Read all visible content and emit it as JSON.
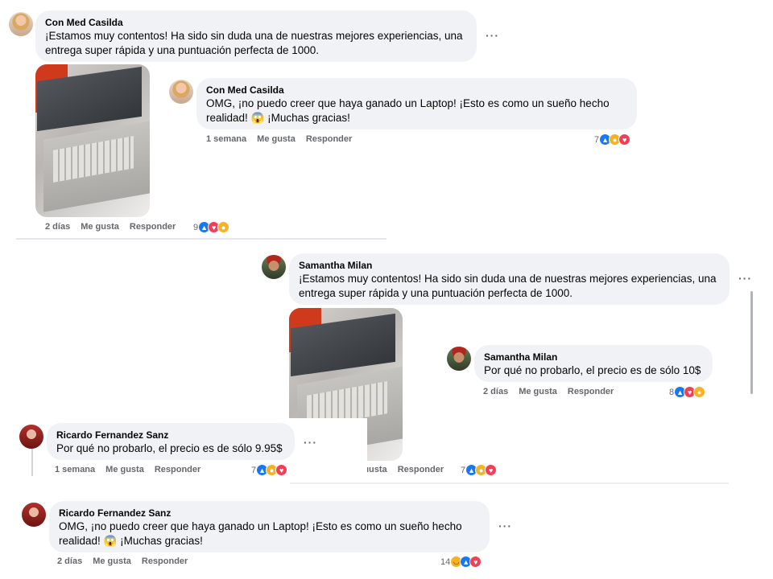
{
  "comment1": {
    "author": "Con Med Casilda",
    "text": "¡Estamos muy contentos! Ha sido sin duda una de nuestras mejores experiencias, una entrega super rápida y una puntuación perfecta de 1000.",
    "time": "2 días",
    "like_label": "Me gusta",
    "reply_label": "Responder",
    "reaction_count": "9",
    "reactions": [
      "like-icon",
      "love-icon",
      "care-icon"
    ]
  },
  "reply1": {
    "author": "Con Med Casilda",
    "text_a": "OMG, ¡no puedo creer que haya ganado un Laptop! ¡Esto es como un sueño hecho realidad!",
    "emoji": "😱",
    "text_b": "¡Muchas gracias!",
    "time": "1 semana",
    "like_label": "Me gusta",
    "reply_label": "Responder",
    "reaction_count": "7",
    "reactions": [
      "like-icon",
      "care-icon",
      "love-icon"
    ]
  },
  "comment2": {
    "author": "Samantha Milan",
    "text": "¡Estamos muy contentos! Ha sido sin duda una de nuestras mejores experiencias, una entrega super rápida y una puntuación perfecta de 1000.",
    "time_fragment": "ıusta",
    "reply_label": "Responder",
    "reaction_count": "7",
    "reactions": [
      "like-icon",
      "care-icon",
      "love-icon"
    ]
  },
  "reply2": {
    "author": "Samantha Milan",
    "text": "Por qué no probarlo, el precio es de sólo 10$",
    "time": "2 días",
    "like_label": "Me gusta",
    "reply_label": "Responder",
    "reaction_count": "8",
    "reactions": [
      "like-icon",
      "love-icon",
      "care-icon"
    ]
  },
  "comment3": {
    "author": "Ricardo Fernandez Sanz",
    "text": "Por qué no probarlo, el precio es de sólo 9.95$",
    "time": "1 semana",
    "like_label": "Me gusta",
    "reply_label": "Responder",
    "reaction_count": "7",
    "reactions": [
      "like-icon",
      "care-icon",
      "love-icon"
    ]
  },
  "comment4": {
    "author": "Ricardo Fernandez Sanz",
    "text_a": "OMG, ¡no puedo creer que haya ganado un Laptop! ¡Esto es como un sueño hecho realidad!",
    "emoji": "😱",
    "text_b": "¡Muchas gracias!",
    "time": "2 días",
    "like_label": "Me gusta",
    "reply_label": "Responder",
    "reaction_count": "14",
    "reactions": [
      "haha-icon",
      "like-icon",
      "love-icon"
    ]
  },
  "more_label": "···",
  "colors": {
    "bubble": "#f0f2f5",
    "like": "#1877f2",
    "love": "#f33e58",
    "care": "#f7b125",
    "meta": "#65676b"
  }
}
